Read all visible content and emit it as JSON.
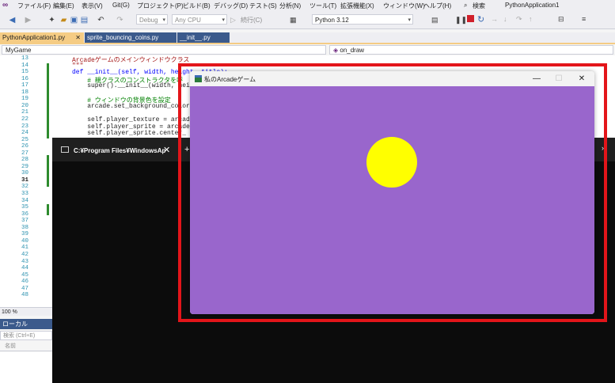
{
  "menu": {
    "items": [
      "ファイル(F)",
      "編集(E)",
      "表示(V)",
      "Git(G)",
      "プロジェクト(P)",
      "ビルド(B)",
      "デバッグ(D)",
      "テスト(S)",
      "分析(N)",
      "ツール(T)",
      "拡張機能(X)",
      "ウィンドウ(W)",
      "ヘルプ(H)"
    ],
    "search_label": "検索",
    "solution_name": "PythonApplication1"
  },
  "toolbar": {
    "config_value": "Debug",
    "platform_value": "Any CPU",
    "continue_label": "続行(C)",
    "python_version": "Python 3.12"
  },
  "tabs": [
    {
      "label": "PythonApplication1.py"
    },
    {
      "label": "sprite_bouncing_coins.py"
    },
    {
      "label": "__init__.py"
    }
  ],
  "nav": {
    "class_selector": "MyGame",
    "member_selector": "on_draw"
  },
  "editor": {
    "lines": [
      {
        "num": "13",
        "text": "Arcadeゲームのメインウィンドウクラス",
        "style": "str"
      },
      {
        "num": "14",
        "text": "\"\"\"",
        "style": "str"
      },
      {
        "num": "15",
        "text": "def __init__(self, width, height, title):",
        "style": "kw"
      },
      {
        "num": "16",
        "text": "    # 親クラスのコンストラクタを呼",
        "style": "cmt"
      },
      {
        "num": "17",
        "text": "    super().__init__(width, heigh",
        "style": "plain"
      },
      {
        "num": "18",
        "text": "",
        "style": "plain"
      },
      {
        "num": "19",
        "text": "    # ウィンドウの背景色を設定",
        "style": "cmt"
      },
      {
        "num": "20",
        "text": "    arcade.set_background_color(a",
        "style": "plain"
      },
      {
        "num": "21",
        "text": "",
        "style": "plain"
      },
      {
        "num": "22",
        "text": "    self.player_texture = arcade.",
        "style": "plain"
      },
      {
        "num": "23",
        "text": "    self.player_sprite = arcade.S",
        "style": "plain"
      },
      {
        "num": "24",
        "text": "    self.player_sprite.center_",
        "style": "plain"
      },
      {
        "num": "25",
        "text": "",
        "style": "plain"
      },
      {
        "num": "26",
        "text": "",
        "style": "plain"
      },
      {
        "num": "27",
        "text": "",
        "style": "plain"
      },
      {
        "num": "28",
        "text": "",
        "style": "plain"
      },
      {
        "num": "29",
        "text": "",
        "style": "plain"
      },
      {
        "num": "30",
        "text": "",
        "style": "plain"
      },
      {
        "num": "31",
        "text": "",
        "style": "plain"
      },
      {
        "num": "32",
        "text": "",
        "style": "plain"
      },
      {
        "num": "33",
        "text": "",
        "style": "plain"
      },
      {
        "num": "34",
        "text": "",
        "style": "plain"
      },
      {
        "num": "35",
        "text": "",
        "style": "plain"
      },
      {
        "num": "36",
        "text": "",
        "style": "plain"
      },
      {
        "num": "37",
        "text": "",
        "style": "plain"
      },
      {
        "num": "38",
        "text": "",
        "style": "plain"
      },
      {
        "num": "39",
        "text": "",
        "style": "plain"
      },
      {
        "num": "40",
        "text": "",
        "style": "plain"
      },
      {
        "num": "41",
        "text": "",
        "style": "plain"
      },
      {
        "num": "42",
        "text": "",
        "style": "plain"
      },
      {
        "num": "43",
        "text": "",
        "style": "plain"
      },
      {
        "num": "44",
        "text": "",
        "style": "plain"
      },
      {
        "num": "45",
        "text": "",
        "style": "plain"
      },
      {
        "num": "46",
        "text": "",
        "style": "plain"
      },
      {
        "num": "47",
        "text": "",
        "style": "plain"
      },
      {
        "num": "48",
        "text": "",
        "style": "plain"
      }
    ],
    "zoom": "100 %"
  },
  "locals": {
    "title": "ローカル",
    "search_placeholder": "検索 (Ctrl+E)",
    "column_name": "名前"
  },
  "terminal": {
    "title": "C:¥Program Files¥WindowsAp"
  },
  "arcade_window": {
    "title": "私のArcadeゲーム",
    "background_color": "#9966cc",
    "coin_color": "#ffff00"
  },
  "highlight": {
    "color": "#e3151a"
  }
}
